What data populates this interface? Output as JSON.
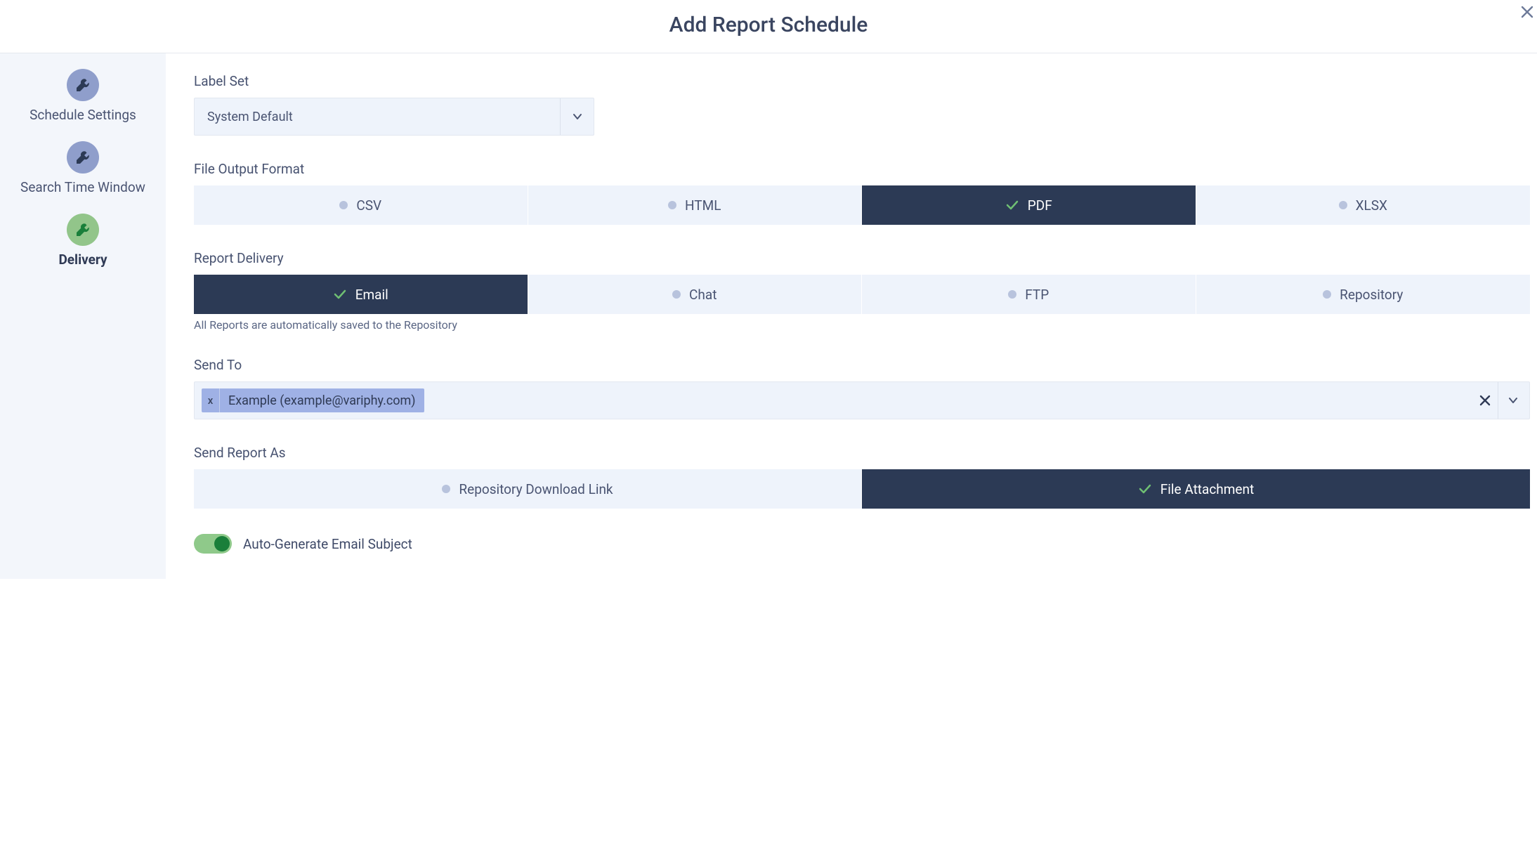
{
  "header": {
    "title": "Add Report Schedule"
  },
  "sidebar": {
    "steps": [
      {
        "label": "Schedule Settings",
        "active": false
      },
      {
        "label": "Search Time Window",
        "active": false
      },
      {
        "label": "Delivery",
        "active": true
      }
    ]
  },
  "main": {
    "label_set": {
      "label": "Label Set",
      "value": "System Default"
    },
    "file_output": {
      "label": "File Output Format",
      "options": [
        "CSV",
        "HTML",
        "PDF",
        "XLSX"
      ],
      "selected": "PDF"
    },
    "report_delivery": {
      "label": "Report Delivery",
      "options": [
        "Email",
        "Chat",
        "FTP",
        "Repository"
      ],
      "selected": "Email",
      "hint": "All Reports are automatically saved to the Repository"
    },
    "send_to": {
      "label": "Send To",
      "tags": [
        {
          "text": "Example (example@variphy.com)"
        }
      ]
    },
    "send_report_as": {
      "label": "Send Report As",
      "options": [
        "Repository Download Link",
        "File Attachment"
      ],
      "selected": "File Attachment"
    },
    "auto_generate_subject": {
      "label": "Auto-Generate Email Subject",
      "value": true
    }
  }
}
